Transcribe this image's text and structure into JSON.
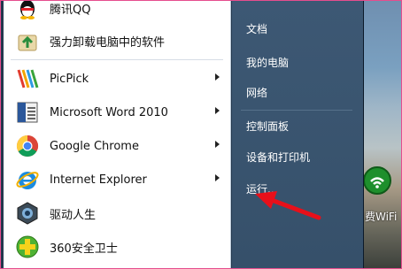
{
  "left_items": [
    {
      "label": "腾讯QQ",
      "icon": "qq-penguin-icon",
      "has_arrow": false
    },
    {
      "label": "强力卸载电脑中的软件",
      "icon": "uninstall-box-icon",
      "has_arrow": false
    },
    {
      "label": "PicPick",
      "icon": "picpick-icon",
      "has_arrow": true
    },
    {
      "label": "Microsoft Word 2010",
      "icon": "word-document-icon",
      "has_arrow": true
    },
    {
      "label": "Google Chrome",
      "icon": "chrome-icon",
      "has_arrow": true
    },
    {
      "label": "Internet Explorer",
      "icon": "internet-explorer-icon",
      "has_arrow": true
    },
    {
      "label": "驱动人生",
      "icon": "driver-life-icon",
      "has_arrow": false
    },
    {
      "label": "360安全卫士",
      "icon": "360-security-icon",
      "has_arrow": false
    }
  ],
  "right_items": [
    {
      "label": "文档"
    },
    {
      "label": "我的电脑"
    },
    {
      "label": "网络"
    },
    {
      "label": "控制面板"
    },
    {
      "label": "设备和打印机"
    },
    {
      "label": "运行..."
    }
  ],
  "desktop": {
    "wifi_label": "费WiFi"
  },
  "colors": {
    "annotation_arrow": "#e8101a",
    "right_pane": "#3a5570"
  }
}
